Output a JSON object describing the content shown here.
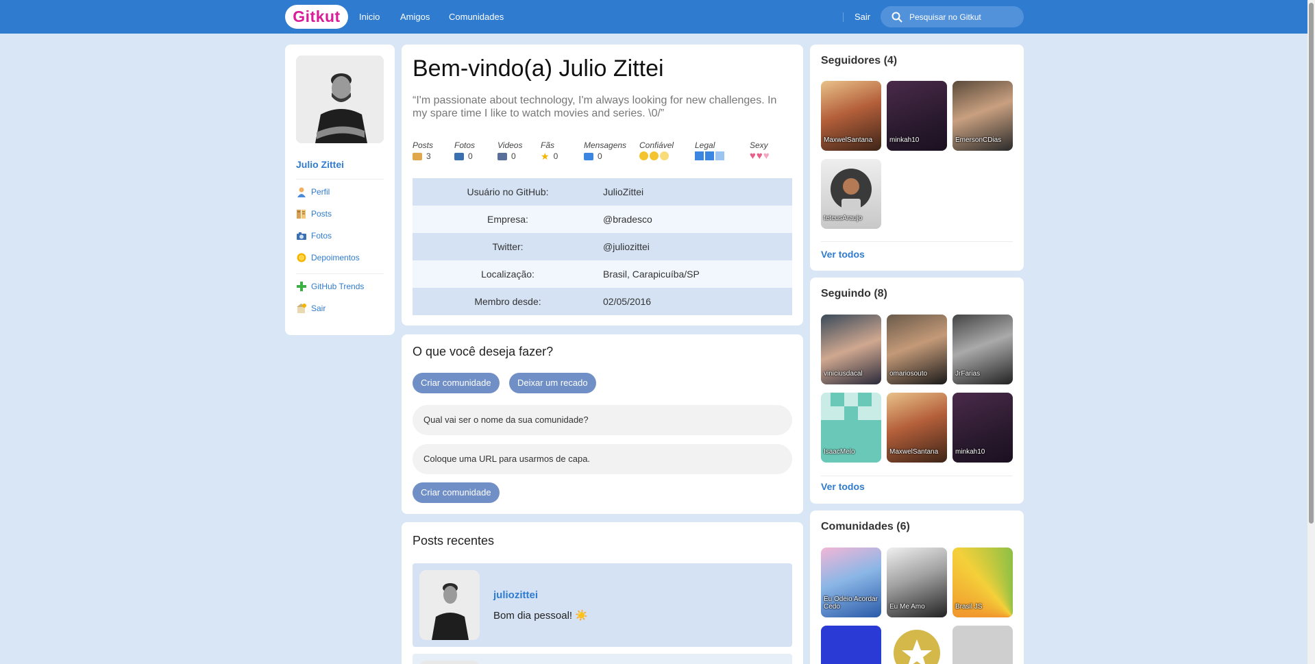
{
  "header": {
    "logo": "Gitkut",
    "nav": [
      "Inicio",
      "Amigos",
      "Comunidades"
    ],
    "logout": "Sair",
    "search_placeholder": "Pesquisar no Gitkut"
  },
  "profile": {
    "name": "Julio Zittei",
    "menu": [
      "Perfil",
      "Posts",
      "Fotos",
      "Depoimentos"
    ],
    "menu2": [
      "GitHub Trends",
      "Sair"
    ]
  },
  "welcome": {
    "title": "Bem-vindo(a) Julio Zittei",
    "bio": "“I'm passionate about technology, I'm always looking for new challenges. In my spare time I like to watch movies and series. \\0/”",
    "stats": [
      {
        "label": "Posts",
        "value": "3"
      },
      {
        "label": "Fotos",
        "value": "0"
      },
      {
        "label": "Videos",
        "value": "0"
      },
      {
        "label": "Fãs",
        "value": "0"
      },
      {
        "label": "Mensagens",
        "value": "0"
      },
      {
        "label": "Confiável",
        "value": ""
      },
      {
        "label": "Legal",
        "value": ""
      },
      {
        "label": "Sexy",
        "value": ""
      }
    ],
    "info": [
      {
        "key": "Usuário no GitHub:",
        "value": "JulioZittei"
      },
      {
        "key": "Empresa:",
        "value": "@bradesco"
      },
      {
        "key": "Twitter:",
        "value": "@juliozittei"
      },
      {
        "key": "Localização:",
        "value": "Brasil, Carapicuíba/SP"
      },
      {
        "key": "Membro desde:",
        "value": "02/05/2016"
      }
    ]
  },
  "actions": {
    "title": "O que você deseja fazer?",
    "tab_create": "Criar comunidade",
    "tab_message": "Deixar um recado",
    "name_placeholder": "Qual vai ser o nome da sua comunidade?",
    "url_placeholder": "Coloque uma URL para usarmos de capa.",
    "submit": "Criar comunidade"
  },
  "posts": {
    "title": "Posts recentes",
    "items": [
      {
        "author": "juliozittei",
        "text": "Bom dia pessoal! ☀️"
      }
    ]
  },
  "followers": {
    "title": "Seguidores (4)",
    "users": [
      "MaxwelSantana",
      "minkah10",
      "EmersonCDias",
      "teteusAraujo"
    ],
    "see_all": "Ver todos"
  },
  "following": {
    "title": "Seguindo (8)",
    "users": [
      "viniciusdacal",
      "omariosouto",
      "JrFarias",
      "IsaacMelo",
      "MaxwelSantana",
      "minkah10"
    ],
    "see_all": "Ver todos"
  },
  "communities": {
    "title": "Comunidades (6)",
    "items": [
      "Eu Odeio Acordar Cedo",
      "Eu Me Amo",
      "Brasil JS"
    ]
  }
}
